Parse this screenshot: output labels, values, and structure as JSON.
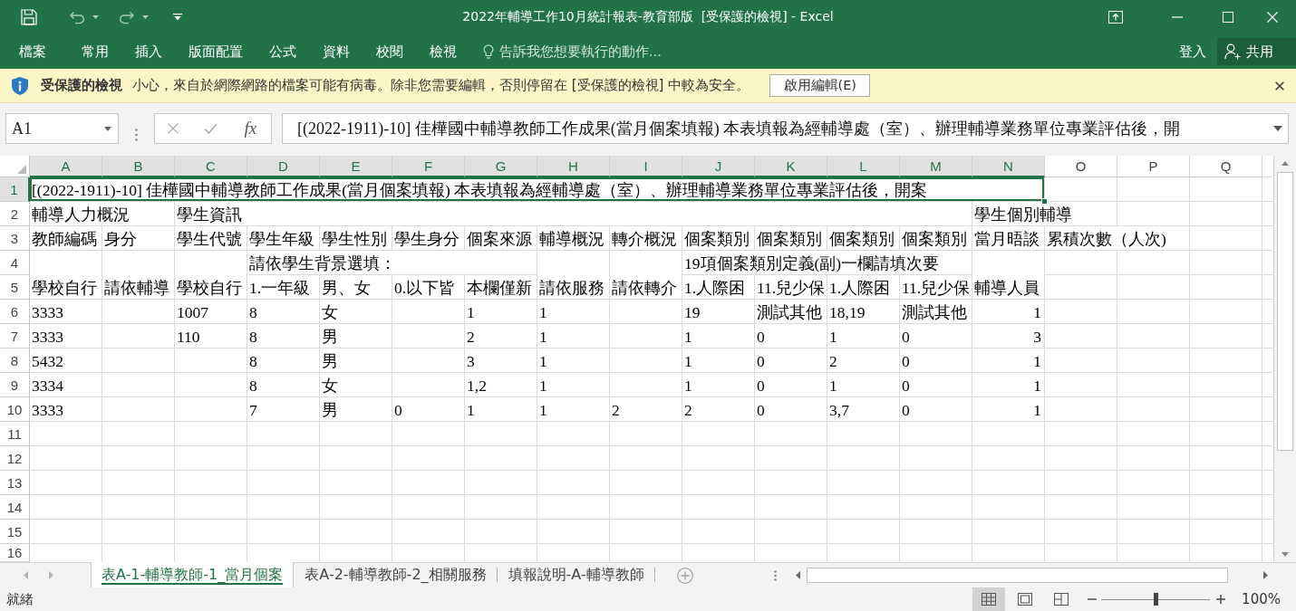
{
  "window": {
    "title": "2022年輔導工作10月統計報表-教育部版  [受保護的檢視] - Excel"
  },
  "ribbon": {
    "tabs": [
      "檔案",
      "常用",
      "插入",
      "版面配置",
      "公式",
      "資料",
      "校閱",
      "檢視"
    ],
    "tell_me": {
      "placeholder": "告訴我您想要執行的動作..."
    },
    "sign_in": "登入",
    "share": "共用"
  },
  "protected_view": {
    "title": "受保護的檢視",
    "message": "小心，來自於網際網路的檔案可能有病毒。除非您需要編輯，否則停留在 [受保護的檢視] 中較為安全。",
    "button": "啟用編輯(E)"
  },
  "formula_bar": {
    "name_box": "A1",
    "function_button": "fx",
    "formula": "[(2022-1911)-10] 佳樺國中輔導教師工作成果(當月個案填報) 本表填報為經輔導處（室）、辦理輔導業務單位專業評估後，開"
  },
  "sheet": {
    "columns": [
      {
        "label": "A",
        "selected": true
      },
      {
        "label": "B",
        "selected": true
      },
      {
        "label": "C",
        "selected": true
      },
      {
        "label": "D",
        "selected": true
      },
      {
        "label": "E",
        "selected": true
      },
      {
        "label": "F",
        "selected": true
      },
      {
        "label": "G",
        "selected": true
      },
      {
        "label": "H",
        "selected": true
      },
      {
        "label": "I",
        "selected": true
      },
      {
        "label": "J",
        "selected": true
      },
      {
        "label": "K",
        "selected": true
      },
      {
        "label": "L",
        "selected": true
      },
      {
        "label": "M",
        "selected": true
      },
      {
        "label": "N",
        "selected": true
      },
      {
        "label": "O",
        "selected": false
      },
      {
        "label": "P",
        "selected": false
      },
      {
        "label": "Q",
        "selected": false
      }
    ],
    "rows": [
      {
        "label": "1",
        "selected": true,
        "cells": [
          {
            "text": "[(2022-1911)-10] 佳樺國中輔導教師工作成果(當月個案填報) 本表填報為經輔導處（室）、辦理輔導業務單位專業評估後，開案",
            "kind": "text"
          }
        ]
      },
      {
        "label": "2",
        "selected": false,
        "cells": [
          {
            "text": "輔導人力概況",
            "kind": "text"
          },
          null,
          {
            "text": "學生資訊",
            "kind": "text"
          },
          null,
          null,
          null,
          null,
          null,
          null,
          null,
          null,
          null,
          null,
          {
            "text": "學生個別輔導",
            "kind": "text"
          }
        ]
      },
      {
        "label": "3",
        "selected": false,
        "cells": [
          {
            "text": "教師編碼",
            "kind": "text"
          },
          {
            "text": "身分",
            "kind": "text"
          },
          {
            "text": "學生代號",
            "kind": "text"
          },
          {
            "text": "學生年級",
            "kind": "text"
          },
          {
            "text": "學生性別",
            "kind": "text"
          },
          {
            "text": "學生身分",
            "kind": "text"
          },
          {
            "text": "個案來源",
            "kind": "text"
          },
          {
            "text": "輔導概況",
            "kind": "text"
          },
          {
            "text": "轉介概況",
            "kind": "text"
          },
          {
            "text": "個案類別",
            "kind": "text"
          },
          {
            "text": "個案類別",
            "kind": "text"
          },
          {
            "text": "個案類別",
            "kind": "text"
          },
          {
            "text": "個案類別",
            "kind": "text"
          },
          {
            "text": "當月晤談",
            "kind": "text"
          },
          {
            "text": "累積次數（人次)",
            "kind": "text"
          }
        ]
      },
      {
        "label": "4",
        "selected": false,
        "cells": [
          null,
          null,
          null,
          {
            "text": "請依學生背景選填：",
            "kind": "text"
          },
          null,
          null,
          null,
          null,
          null,
          {
            "text": "19項個案類別定義(副)一欄請填次要",
            "kind": "text"
          }
        ]
      },
      {
        "label": "5",
        "selected": false,
        "cells": [
          {
            "text": "學校自行",
            "kind": "text"
          },
          {
            "text": "請依輔導",
            "kind": "text"
          },
          {
            "text": "學校自行",
            "kind": "text"
          },
          {
            "text": "1.一年級",
            "kind": "text"
          },
          {
            "text": "男、女",
            "kind": "text"
          },
          {
            "text": "0.以下皆",
            "kind": "text"
          },
          {
            "text": "本欄僅新",
            "kind": "text"
          },
          {
            "text": "請依服務",
            "kind": "text"
          },
          {
            "text": "請依轉介",
            "kind": "text"
          },
          {
            "text": "1.人際困",
            "kind": "text"
          },
          {
            "text": "11.兒少保",
            "kind": "text"
          },
          {
            "text": "1.人際困",
            "kind": "text"
          },
          {
            "text": "11.兒少保",
            "kind": "text"
          },
          {
            "text": "輔導人員",
            "kind": "text"
          }
        ]
      },
      {
        "label": "6",
        "selected": false,
        "cells": [
          {
            "text": "3333",
            "kind": "text"
          },
          null,
          {
            "text": "1007",
            "kind": "text"
          },
          {
            "text": "8",
            "kind": "text"
          },
          {
            "text": "女",
            "kind": "text"
          },
          null,
          {
            "text": "1",
            "kind": "text"
          },
          {
            "text": "1",
            "kind": "text"
          },
          null,
          {
            "text": "19",
            "kind": "text"
          },
          {
            "text": "測試其他",
            "kind": "text"
          },
          {
            "text": "18,19",
            "kind": "text"
          },
          {
            "text": "測試其他",
            "kind": "text"
          },
          {
            "text": "1",
            "kind": "number"
          }
        ]
      },
      {
        "label": "7",
        "selected": false,
        "cells": [
          {
            "text": "3333",
            "kind": "text"
          },
          null,
          {
            "text": "110",
            "kind": "text"
          },
          {
            "text": "8",
            "kind": "text"
          },
          {
            "text": "男",
            "kind": "text"
          },
          null,
          {
            "text": "2",
            "kind": "text"
          },
          {
            "text": "1",
            "kind": "text"
          },
          null,
          {
            "text": "1",
            "kind": "text"
          },
          {
            "text": "0",
            "kind": "text"
          },
          {
            "text": "1",
            "kind": "text"
          },
          {
            "text": "0",
            "kind": "text"
          },
          {
            "text": "3",
            "kind": "number"
          }
        ]
      },
      {
        "label": "8",
        "selected": false,
        "cells": [
          {
            "text": "5432",
            "kind": "text"
          },
          null,
          null,
          {
            "text": "8",
            "kind": "text"
          },
          {
            "text": "男",
            "kind": "text"
          },
          null,
          {
            "text": "3",
            "kind": "text"
          },
          {
            "text": "1",
            "kind": "text"
          },
          null,
          {
            "text": "1",
            "kind": "text"
          },
          {
            "text": "0",
            "kind": "text"
          },
          {
            "text": "2",
            "kind": "text"
          },
          {
            "text": "0",
            "kind": "text"
          },
          {
            "text": "1",
            "kind": "number"
          }
        ]
      },
      {
        "label": "9",
        "selected": false,
        "cells": [
          {
            "text": "3334",
            "kind": "text"
          },
          null,
          null,
          {
            "text": "8",
            "kind": "text"
          },
          {
            "text": "女",
            "kind": "text"
          },
          null,
          {
            "text": "1,2",
            "kind": "text"
          },
          {
            "text": "1",
            "kind": "text"
          },
          null,
          {
            "text": "1",
            "kind": "text"
          },
          {
            "text": "0",
            "kind": "text"
          },
          {
            "text": "1",
            "kind": "text"
          },
          {
            "text": "0",
            "kind": "text"
          },
          {
            "text": "1",
            "kind": "number"
          }
        ]
      },
      {
        "label": "10",
        "selected": false,
        "cells": [
          {
            "text": "3333",
            "kind": "text"
          },
          null,
          null,
          {
            "text": "7",
            "kind": "text"
          },
          {
            "text": "男",
            "kind": "text"
          },
          {
            "text": "0",
            "kind": "text"
          },
          {
            "text": "1",
            "kind": "text"
          },
          {
            "text": "1",
            "kind": "text"
          },
          {
            "text": "2",
            "kind": "text"
          },
          {
            "text": "2",
            "kind": "text"
          },
          {
            "text": "0",
            "kind": "text"
          },
          {
            "text": "3,7",
            "kind": "text"
          },
          {
            "text": "0",
            "kind": "text"
          },
          {
            "text": "1",
            "kind": "number"
          }
        ]
      },
      {
        "label": "11",
        "selected": false
      },
      {
        "label": "12",
        "selected": false
      },
      {
        "label": "13",
        "selected": false
      },
      {
        "label": "14",
        "selected": false
      },
      {
        "label": "15",
        "selected": false
      },
      {
        "label": "16",
        "selected": false
      }
    ]
  },
  "sheet_tabs": [
    {
      "label": "表A-1-輔導教師-1_當月個案",
      "selected": true
    },
    {
      "label": "表A-2-輔導教師-2_相關服務",
      "selected": false
    },
    {
      "label": "填報說明-A-輔導教師",
      "selected": false
    }
  ],
  "status_bar": {
    "status": "就緒",
    "views": [
      {
        "kind": "normal",
        "selected": true
      },
      {
        "kind": "page_layout",
        "selected": false
      },
      {
        "kind": "page_break",
        "selected": false
      }
    ],
    "zoom": {
      "level": 0.5,
      "reading": "100%"
    }
  }
}
